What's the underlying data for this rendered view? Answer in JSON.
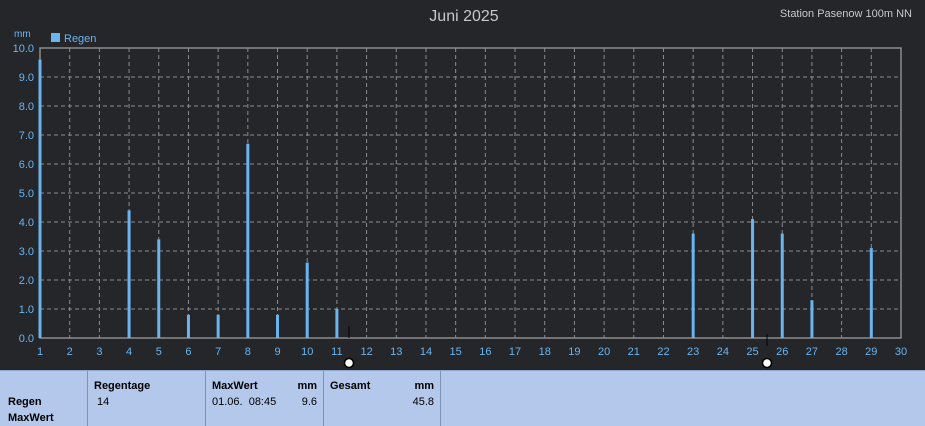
{
  "chart_data": {
    "type": "bar",
    "title": "Juni 2025",
    "station": "Station Pasenow 100m NN",
    "ylabel": "mm",
    "ylim": [
      0,
      10
    ],
    "yticks": [
      "0.0",
      "1.0",
      "2.0",
      "3.0",
      "4.0",
      "5.0",
      "6.0",
      "7.0",
      "8.0",
      "9.0",
      "10.0"
    ],
    "xlim": [
      1,
      30
    ],
    "xticks": [
      "1",
      "2",
      "3",
      "4",
      "5",
      "6",
      "7",
      "8",
      "9",
      "10",
      "11",
      "12",
      "13",
      "14",
      "15",
      "16",
      "17",
      "18",
      "19",
      "20",
      "21",
      "22",
      "23",
      "24",
      "25",
      "26",
      "27",
      "28",
      "29",
      "30"
    ],
    "legend": "Regen",
    "legend_position": "top-left",
    "grid": true,
    "colors": {
      "bar": "#6ab4f0",
      "background": "#24262a",
      "grid": "#8c8c8c",
      "axis_text": "#6ab4f0"
    },
    "series": [
      {
        "name": "Regen",
        "x": [
          1,
          4,
          5,
          6,
          7,
          8,
          9,
          10,
          11,
          23,
          25,
          26,
          27,
          29
        ],
        "values": [
          9.6,
          4.4,
          3.4,
          0.8,
          0.8,
          6.7,
          0.8,
          2.6,
          1.0,
          3.6,
          4.1,
          3.6,
          1.3,
          3.1
        ]
      }
    ]
  },
  "footer": {
    "row_title": "Regen",
    "row_subtitle": "MaxWert",
    "regentage_label": "Regentage",
    "regentage_value": "14",
    "maxwert_label": "MaxWert",
    "maxwert_unit": "mm",
    "maxwert_time": "01.06.  08:45",
    "maxwert_value": "9.6",
    "gesamt_label": "Gesamt",
    "gesamt_unit": "mm",
    "gesamt_value": "45.8"
  }
}
